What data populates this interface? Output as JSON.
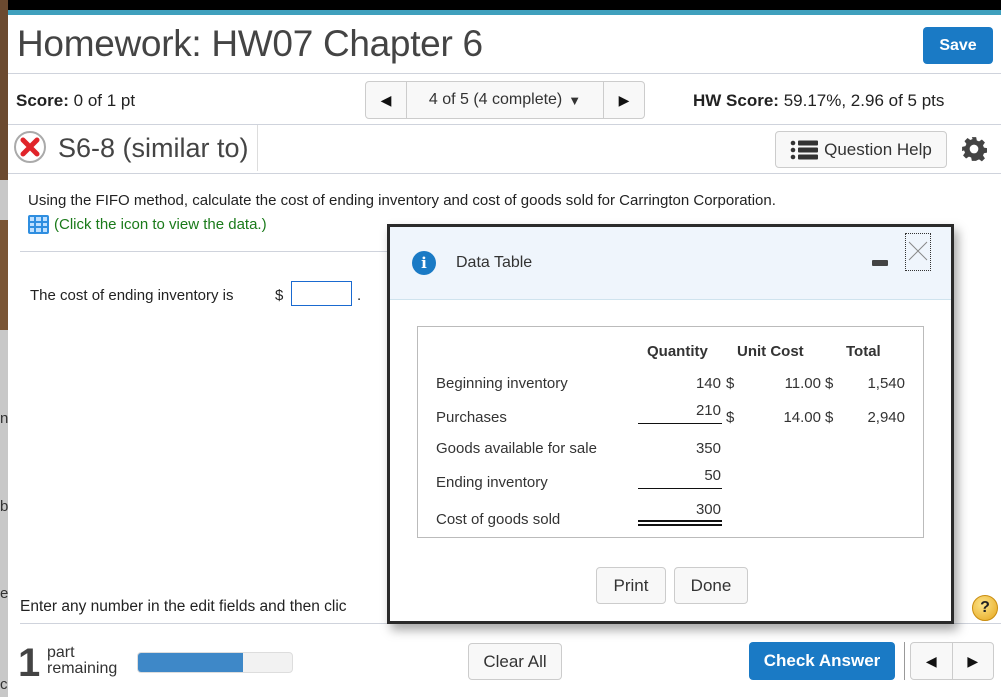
{
  "header": {
    "title": "Homework: HW07 Chapter 6",
    "save_label": "Save"
  },
  "status": {
    "score_label": "Score:",
    "score_value": "0 of 1 pt",
    "question_nav": "4 of 5 (4 complete)",
    "hw_score_label": "HW Score:",
    "hw_score_value": "59.17%, 2.96 of 5 pts"
  },
  "question": {
    "id": "S6-8 (similar to)",
    "status": "incorrect",
    "help_label": "Question Help",
    "prompt": "Using the FIFO method, calculate the cost of ending inventory and cost of goods sold for Carrington Corporation.",
    "data_link": "(Click the icon to view the data.)",
    "ending_label": "The cost of ending inventory is",
    "currency": "$",
    "ending_value": "",
    "period": "."
  },
  "left_edge_fragments": [
    "n",
    "b",
    "e",
    "c"
  ],
  "instructions": "Enter any number in the edit fields and then clic",
  "footer": {
    "parts_count": "1",
    "parts_label_line1": "part",
    "parts_label_line2": "remaining",
    "progress_fraction": 0.68,
    "clear_label": "Clear All",
    "check_label": "Check Answer",
    "help_glyph": "?"
  },
  "dialog": {
    "title": "Data Table",
    "print_label": "Print",
    "done_label": "Done",
    "columns": [
      "Quantity",
      "Unit Cost",
      "Total"
    ],
    "rows": [
      {
        "label": "Beginning inventory",
        "quantity": "140",
        "q_dollar": "$",
        "unit_cost": "11.00",
        "u_dollar": "$",
        "total": "1,540"
      },
      {
        "label": "Purchases",
        "quantity": "210",
        "q_dollar": "$",
        "unit_cost": "14.00",
        "u_dollar": "$",
        "total": "2,940"
      },
      {
        "label": "Goods available for sale",
        "quantity": "350"
      },
      {
        "label": "Ending inventory",
        "quantity": "50"
      },
      {
        "label": "Cost of goods sold",
        "quantity": "300"
      }
    ]
  },
  "colors": {
    "accent_blue": "#1a7ac5",
    "top_bar": "#3fa0bd",
    "link_green": "#1a7a1a",
    "error_red": "#e0242a"
  }
}
